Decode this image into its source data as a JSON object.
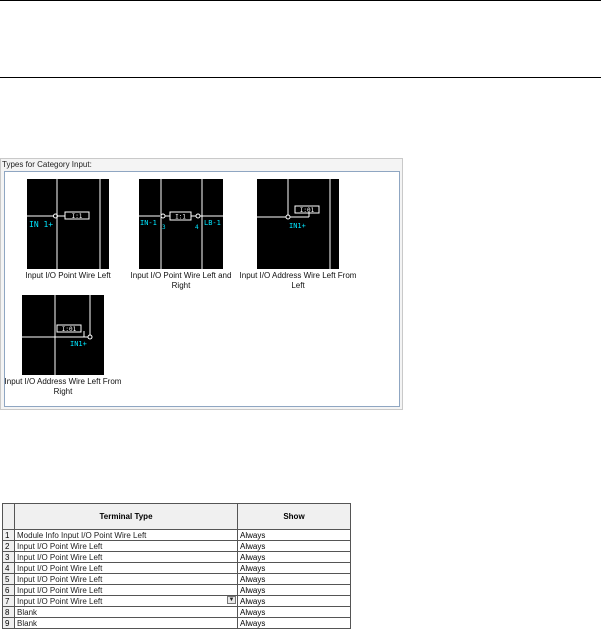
{
  "types_panel": {
    "label": "Types for Category Input:",
    "items": [
      {
        "caption": "Input I/O Point Wire Left",
        "left_text": "IN 1+",
        "box_text": "I:1"
      },
      {
        "caption": "Input I/O Point Wire Left and Right",
        "left_text": "IN-1",
        "right_text": "LB-1",
        "box_text": "I:1",
        "pin_left": "3",
        "pin_right": "4"
      },
      {
        "caption": "Input I/O Address Wire Left From Left",
        "box_text": "I:01",
        "tag_text": "IN1+"
      },
      {
        "caption": "Input I/O Address Wire Left From Right",
        "box_text": "I:01",
        "tag_text": "IN1+"
      }
    ]
  },
  "grid": {
    "headers": {
      "type": "Terminal Type",
      "show": "Show"
    },
    "rows": [
      {
        "num": "1",
        "type": "Module Info Input I/O Point Wire Left",
        "show": "Always"
      },
      {
        "num": "2",
        "type": "Input I/O Point Wire Left",
        "show": "Always"
      },
      {
        "num": "3",
        "type": "Input I/O Point Wire Left",
        "show": "Always"
      },
      {
        "num": "4",
        "type": "Input I/O Point Wire Left",
        "show": "Always"
      },
      {
        "num": "5",
        "type": "Input I/O Point Wire Left",
        "show": "Always"
      },
      {
        "num": "6",
        "type": "Input I/O Point Wire Left",
        "show": "Always"
      },
      {
        "num": "7",
        "type": "Input I/O Point Wire Left",
        "show": "Always"
      },
      {
        "num": "8",
        "type": "Blank",
        "show": "Always"
      },
      {
        "num": "9",
        "type": "Blank",
        "show": "Always"
      }
    ]
  },
  "colors": {
    "thumb_bg": "#000000",
    "wire": "#ffffff",
    "label": "#00e5ff"
  },
  "icons": {
    "dropdown": "chevron-down-icon"
  }
}
